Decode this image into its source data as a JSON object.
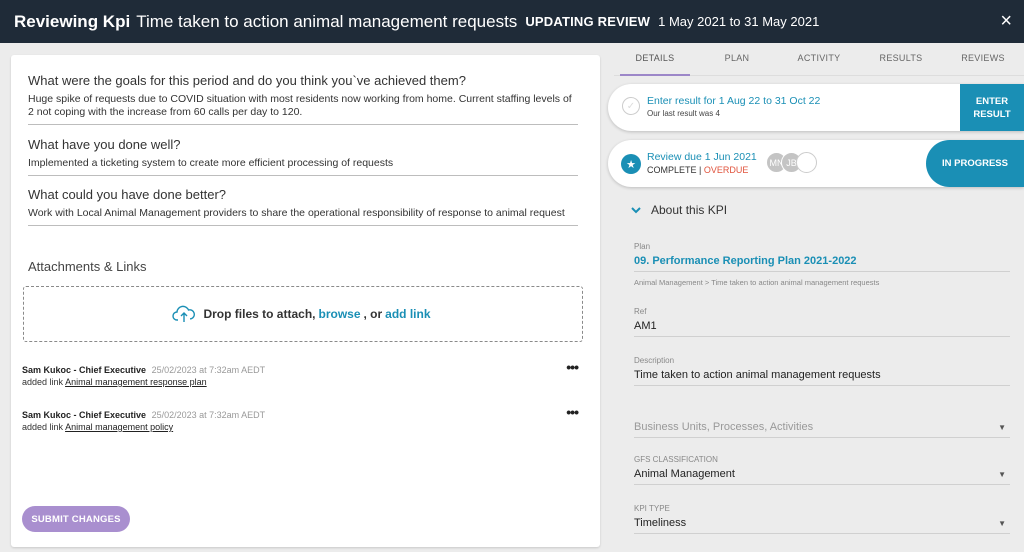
{
  "header": {
    "title": "Reviewing Kpi",
    "kpi_name": "Time taken to action animal management requests",
    "status": "UPDATING REVIEW",
    "dates": "1 May 2021 to 31 May 2021",
    "close_icon": "×"
  },
  "review": {
    "questions": [
      {
        "question": "What were the goals for this period and do you think you`ve achieved them?",
        "answer": "Huge spike of requests due to COVID situation with most residents now working from home. Current staffing levels of 2 not coping with the increase from 60 calls per day to 120."
      },
      {
        "question": "What have you done well?",
        "answer": "Implemented a ticketing system to create more efficient processing of requests"
      },
      {
        "question": "What could you have done better?",
        "answer": "Work with Local Animal Management providers to share the operational responsibility of response to animal request"
      }
    ],
    "attachments_title": "Attachments & Links",
    "dropzone": {
      "prefix": "Drop files to attach,",
      "browse": "browse",
      "or": ", or",
      "add_link": "add link"
    },
    "comments": [
      {
        "author": "Sam Kukoc - Chief Executive",
        "time": "25/02/2023 at 7:32am AEDT",
        "action": "added link",
        "link": "Animal management response plan",
        "menu": "•••"
      },
      {
        "author": "Sam Kukoc - Chief Executive",
        "time": "25/02/2023 at 7:32am AEDT",
        "action": "added link",
        "link": "Animal management policy",
        "menu": "•••"
      }
    ],
    "submit_label": "SUBMIT CHANGES"
  },
  "tabs": [
    "DETAILS",
    "PLAN",
    "ACTIVITY",
    "RESULTS",
    "REVIEWS"
  ],
  "active_tab": "DETAILS",
  "result_card": {
    "main": "Enter result for 1 Aug 22 to 31 Oct 22",
    "sub": "Our last result was 4",
    "button": "ENTER RESULT"
  },
  "review_card": {
    "main": "Review due 1 Jun 2021",
    "complete": "COMPLETE",
    "separator": " | ",
    "overdue": "OVERDUE",
    "avatars": [
      "MN",
      "JB"
    ],
    "button": "IN PROGRESS"
  },
  "about": {
    "title": "About this KPI",
    "plan_label": "Plan",
    "plan_value": "09. Performance Reporting Plan 2021-2022",
    "crumb": "Animal Management > Time taken to action animal management requests",
    "ref_label": "Ref",
    "ref_value": "AM1",
    "description_label": "Description",
    "description_value": "Time taken to action animal management requests",
    "business_units_placeholder": "Business Units, Processes, Activities",
    "gfs_label": "GFS CLASSIFICATION",
    "gfs_value": "Animal Management",
    "kpi_type_label": "KPI TYPE",
    "kpi_type_value": "Timeliness"
  },
  "colors": {
    "header_bg": "#1f2b38",
    "accent": "#1a8fb5",
    "submit": "#a98fcf",
    "overdue": "#e0533c"
  }
}
